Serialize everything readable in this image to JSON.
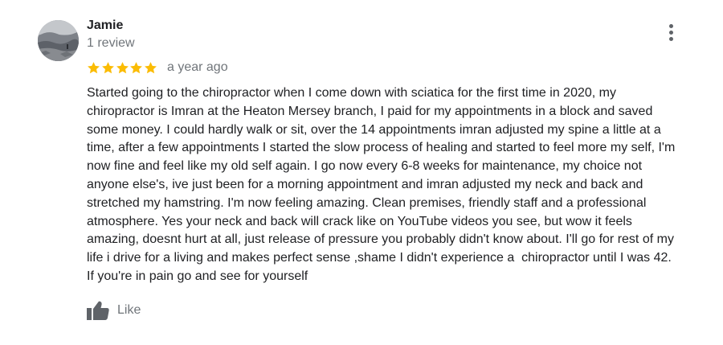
{
  "review": {
    "reviewer_name": "Jamie",
    "review_count": "1 review",
    "rating": 5,
    "rating_max": 5,
    "star_color": "#fbbc04",
    "date": "a year ago",
    "text_lines": [
      "Started going to the chiropractor when I come down with sciatica for the first time in 2020, my",
      "chiropractor is Imran at the Heaton Mersey branch, I paid for my appointments in a block and saved",
      "some money. I could hardly walk or sit, over the 14 appointments imran adjusted my spine a little at a",
      "time, after a few appointments I started the slow process of healing and started to feel more my self, I'm",
      "now fine and feel like my old self again. I go now every 6-8 weeks for maintenance, my choice not",
      "anyone else's, ive just been for a morning appointment and imran adjusted my neck and back and",
      "stretched my hamstring. I'm now feeling amazing. Clean premises, friendly staff and a professional",
      "atmosphere. Yes your neck and back will crack like on YouTube videos you see, but wow it feels",
      "amazing, doesnt hurt at all, just release of pressure you probably didn't know about. I'll go for rest of my",
      "life i drive for a living and makes perfect sense ,shame I didn't experience a  chiropractor until I was 42.",
      "If you're in pain go and see for yourself"
    ],
    "like_label": "Like",
    "icons": {
      "more": "more-vert-icon",
      "star": "star-icon",
      "like": "thumb-up-icon"
    }
  }
}
